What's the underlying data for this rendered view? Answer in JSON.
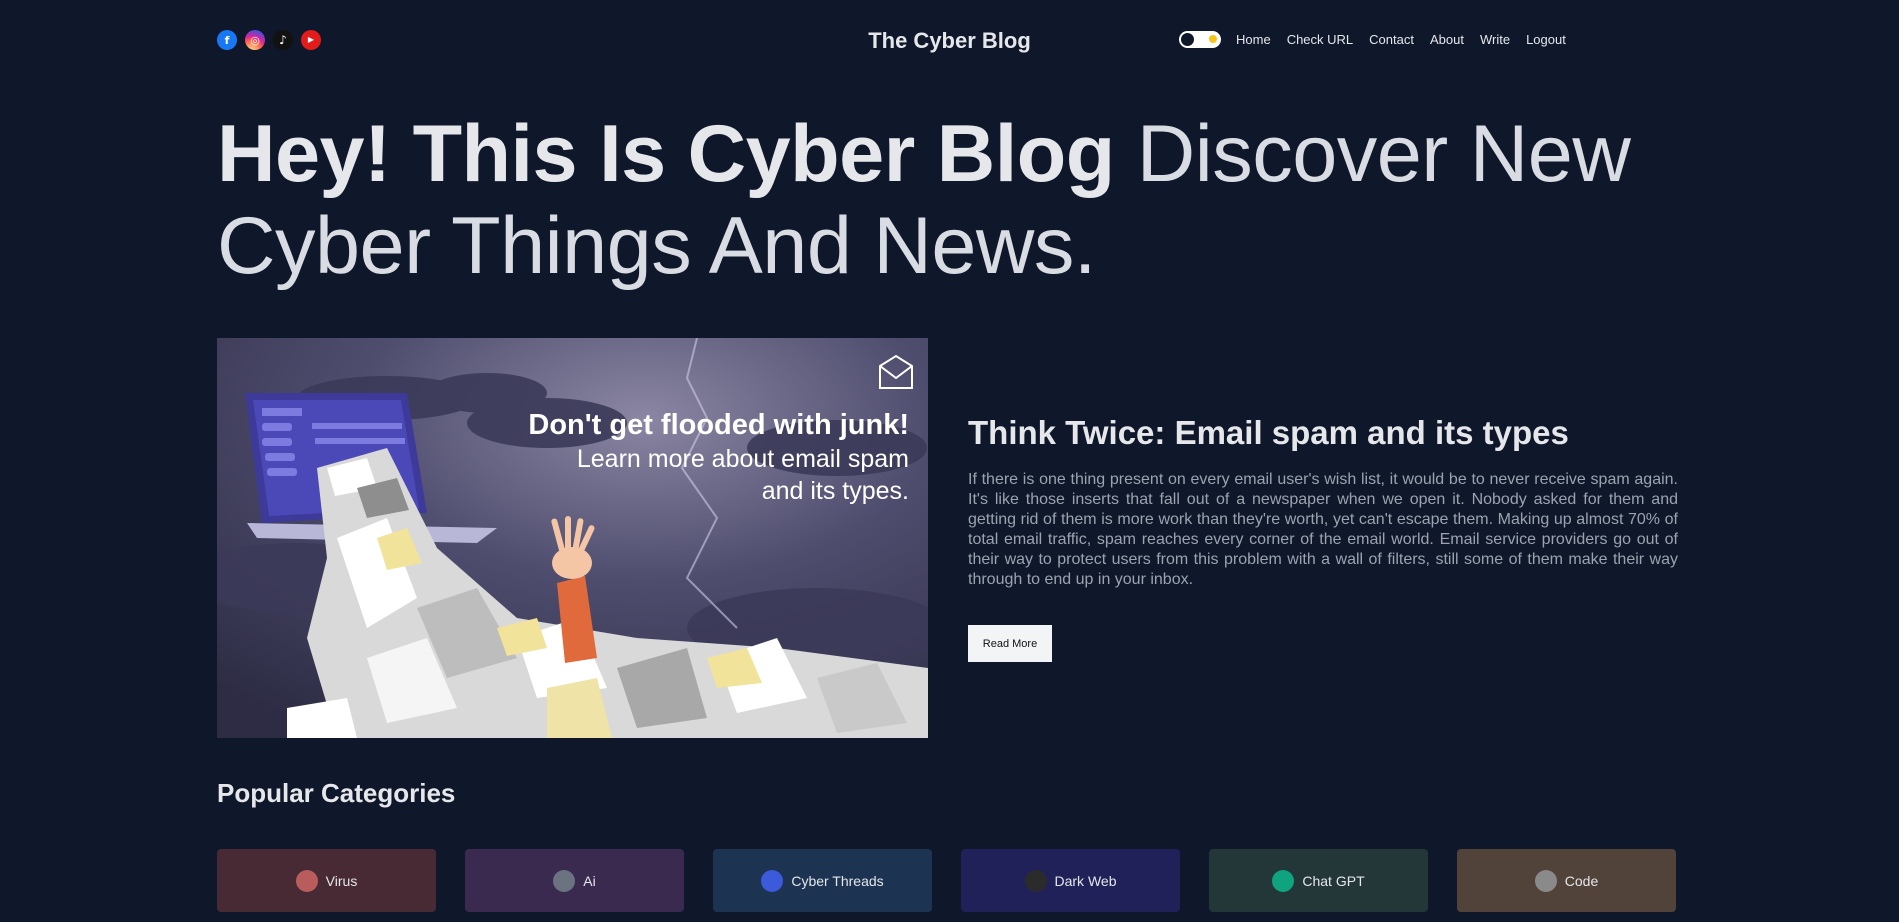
{
  "header": {
    "title": "The Cyber Blog",
    "socials": [
      {
        "icon": "facebook-icon",
        "glyph": "f"
      },
      {
        "icon": "instagram-icon",
        "glyph": "◎"
      },
      {
        "icon": "tiktok-icon",
        "glyph": "♪"
      },
      {
        "icon": "youtube-icon",
        "glyph": "▶"
      }
    ],
    "nav": [
      "Home",
      "Check URL",
      "Contact",
      "About",
      "Write",
      "Logout"
    ]
  },
  "hero": {
    "strong": "Hey! This Is Cyber Blog",
    "light": "Discover New Cyber Things And News."
  },
  "featured": {
    "image": {
      "headline": "Don't get flooded with junk!",
      "line2": "Learn more about email spam",
      "line3": "and its types."
    },
    "title": "Think Twice: Email spam and its types",
    "body": "If there is one thing present on every email user's wish list, it would be to never receive spam again. It's like those inserts that fall out of a newspaper when we open it. Nobody asked for them and getting rid of them is more work than they're worth, yet can't escape them. Making up almost 70% of total email traffic, spam reaches every corner of the email world. Email service providers go out of their way to protect users from this problem with a wall of filters, still some of them make their way through to end up in your inbox.",
    "button": "Read More"
  },
  "categories": {
    "title": "Popular Categories",
    "items": [
      {
        "label": "Virus",
        "bg": "#472a33",
        "icon": "#b85c5c"
      },
      {
        "label": "Ai",
        "bg": "#3a2a50",
        "icon": "#6b7280"
      },
      {
        "label": "Cyber Threads",
        "bg": "#1c3352",
        "icon": "#3b5bdb"
      },
      {
        "label": "Dark Web",
        "bg": "#1f2158",
        "icon": "#2b2b2b"
      },
      {
        "label": "Chat GPT",
        "bg": "#233638",
        "icon": "#10a37f"
      },
      {
        "label": "Code",
        "bg": "#52433a",
        "icon": "#8a8a8a"
      }
    ]
  }
}
